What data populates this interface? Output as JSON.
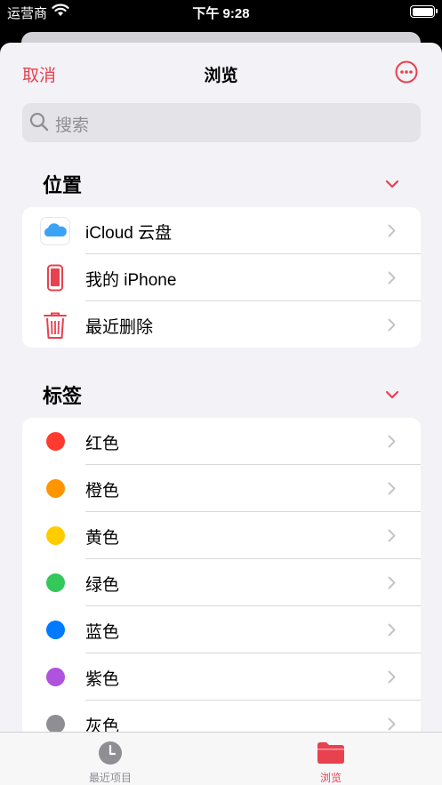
{
  "status_bar": {
    "carrier": "运营商",
    "time": "下午 9:28"
  },
  "nav": {
    "cancel_label": "取消",
    "title": "浏览",
    "more_icon": "ellipsis-circle-icon"
  },
  "search": {
    "placeholder": "搜索"
  },
  "locations": {
    "heading": "位置",
    "items": [
      {
        "label": "iCloud 云盘",
        "icon": "icloud-icon"
      },
      {
        "label": "我的 iPhone",
        "icon": "iphone-icon"
      },
      {
        "label": "最近删除",
        "icon": "trash-icon"
      }
    ]
  },
  "tags": {
    "heading": "标签",
    "items": [
      {
        "label": "红色",
        "color": "#ff3b30"
      },
      {
        "label": "橙色",
        "color": "#ff9500"
      },
      {
        "label": "黄色",
        "color": "#ffcc00"
      },
      {
        "label": "绿色",
        "color": "#34c759"
      },
      {
        "label": "蓝色",
        "color": "#007aff"
      },
      {
        "label": "紫色",
        "color": "#af52de"
      },
      {
        "label": "灰色",
        "color": "#8e8e93"
      }
    ]
  },
  "tabbar": {
    "recent_label": "最近项目",
    "browse_label": "浏览"
  },
  "colors": {
    "accent": "#e8414f",
    "inactive": "#8e8e93"
  }
}
